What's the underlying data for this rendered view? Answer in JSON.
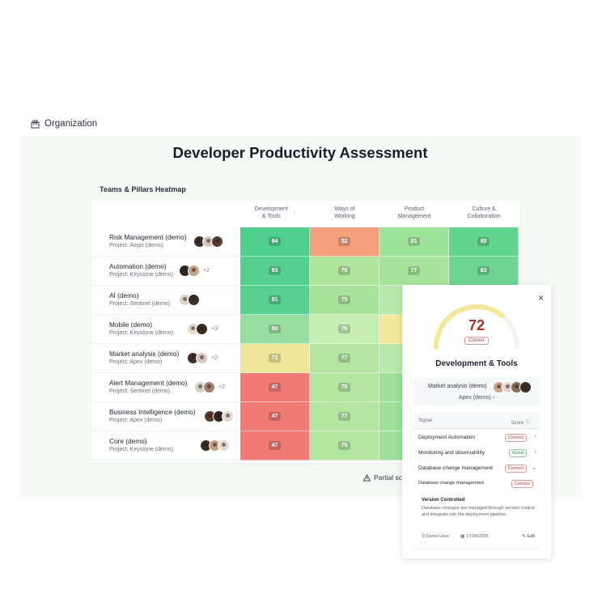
{
  "header": {
    "breadcrumb": "Organization",
    "icon": "building-icon"
  },
  "page": {
    "title": "Developer Productivity Assessment"
  },
  "heatmap": {
    "title": "Teams & Pillars Heatmap",
    "columns": [
      {
        "label_line1": "Development",
        "label_line2": "& Tools",
        "sort_icon": "↑"
      },
      {
        "label_line1": "Ways of",
        "label_line2": "Working"
      },
      {
        "label_line1": "Product",
        "label_line2": "Management"
      },
      {
        "label_line1": "Culture &",
        "label_line2": "Collaboration"
      }
    ],
    "rows": [
      {
        "name": "Risk Management (demo)",
        "project": "Project: Aegis (demo)",
        "avatars": 3,
        "more": "",
        "values": [
          "94",
          "52",
          "81",
          "88"
        ]
      },
      {
        "name": "Automation (demo)",
        "project": "Project: Keystone (demo)",
        "avatars": 2,
        "more": "+2",
        "values": [
          "93",
          "76",
          "77",
          "83"
        ]
      },
      {
        "name": "AI (demo)",
        "project": "Project: Sentinel (demo)",
        "avatars": 2,
        "more": "",
        "values": [
          "91",
          "75",
          "",
          ""
        ]
      },
      {
        "name": "Mobile (demo)",
        "project": "Project: Keystone (demo)",
        "avatars": 2,
        "more": "+3",
        "values": [
          "80",
          "76",
          "",
          ""
        ]
      },
      {
        "name": "Market analysis (demo)",
        "project": "Project: Apex (demo)",
        "avatars": 2,
        "more": "+2",
        "values": [
          "72",
          "77",
          "",
          ""
        ]
      },
      {
        "name": "Alert Management (demo)",
        "project": "Project: Sentinel (demo)",
        "avatars": 2,
        "more": "+2",
        "values": [
          "47",
          "75",
          "",
          ""
        ]
      },
      {
        "name": "Business Intelligence (demo)",
        "project": "Project: Apex (demo)",
        "avatars": 3,
        "more": "",
        "values": [
          "47",
          "77",
          "",
          ""
        ]
      },
      {
        "name": "Core (demo)",
        "project": "Project: Keystone (demo)",
        "avatars": 3,
        "more": "",
        "values": [
          "47",
          "76",
          "",
          ""
        ]
      }
    ],
    "cell_colors": [
      [
        "#4fcf8e",
        "#f4a07c",
        "#9ee39a",
        "#61d48f"
      ],
      [
        "#55d08f",
        "#b0e59c",
        "#a8e49b",
        "#6fd493"
      ],
      [
        "#58d190",
        "#a9e39b",
        "#b6e9ab",
        "#b6e9ab"
      ],
      [
        "#98dea0",
        "#c6edb4",
        "#f3e79c",
        "#b6e9ab"
      ],
      [
        "#f0e69a",
        "#b3e6a0",
        "#b6e9ab",
        "#b6e9ab"
      ],
      [
        "#f07a76",
        "#b3e6a0",
        "#9fe09d",
        "#b6e9ab"
      ],
      [
        "#f07a76",
        "#b3e6a0",
        "#9fe09d",
        "#b6e9ab"
      ],
      [
        "#f07a76",
        "#b3e6a0",
        "#9fe09d",
        "#b6e9ab"
      ]
    ]
  },
  "partial_note": "Partial scor",
  "detail_panel": {
    "close_icon": "×",
    "score": "72",
    "score_status": "Correct",
    "gauge_fraction": 0.72,
    "title": "Development & Tools",
    "team": "Market analysis (demo)",
    "project": "Apex (demo) ›",
    "signals_header": {
      "signal": "Signal",
      "score": "Score ⓘ"
    },
    "signals": [
      {
        "label": "Deployment Automation",
        "status": "Correct",
        "kind": "correct",
        "caret": "›"
      },
      {
        "label": "Monitoring and observability",
        "status": "Good",
        "kind": "good",
        "caret": "›"
      },
      {
        "label": "Database change management",
        "status": "Correct",
        "kind": "correct",
        "caret": "⌄"
      },
      {
        "label": "Database change management",
        "status": "Correct",
        "kind": "correct",
        "caret": ""
      }
    ],
    "expanded": {
      "title": "Version Controlled",
      "description": "Database changes are managed through version control and integrate into the deployment pipeline.",
      "user": "Demo User",
      "date": "17/09/2025",
      "edit": "Edit"
    }
  }
}
